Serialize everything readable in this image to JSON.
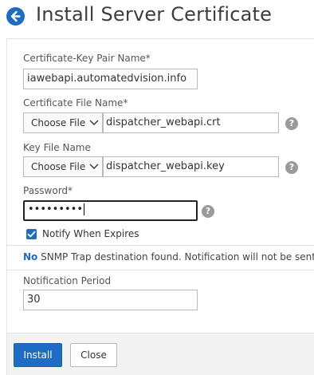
{
  "header": {
    "title": "Install Server Certificate",
    "back_icon": "arrow-left-circle-icon"
  },
  "form": {
    "cert_key_pair": {
      "label": "Certificate-Key Pair Name*",
      "value": "iawebapi.automatedvision.info"
    },
    "cert_file": {
      "label": "Certificate File Name*",
      "choose_label": "Choose File",
      "value": "dispatcher_webapi.crt"
    },
    "key_file": {
      "label": "Key File Name",
      "choose_label": "Choose File",
      "value": "dispatcher_webapi.key"
    },
    "password": {
      "label": "Password*",
      "value": "•••••••••"
    },
    "notify": {
      "label": "Notify When Expires",
      "checked": true
    },
    "snmp_notice": {
      "emphasis": "No",
      "text": " SNMP Trap destination found. Notification will not be sent"
    },
    "notification_period": {
      "label": "Notification Period",
      "value": "30"
    },
    "help_symbol": "?"
  },
  "footer": {
    "install_label": "Install",
    "close_label": "Close"
  },
  "colors": {
    "accent": "#1f6cc4",
    "help_icon": "#9a9a9a",
    "footer_bg": "#f3f3f3"
  }
}
